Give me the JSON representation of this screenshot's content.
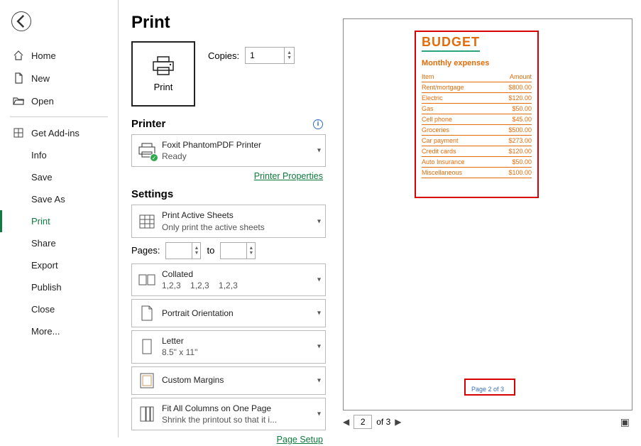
{
  "nav": {
    "home": "Home",
    "new": "New",
    "open": "Open",
    "addins": "Get Add-ins",
    "info": "Info",
    "save": "Save",
    "saveas": "Save As",
    "print": "Print",
    "share": "Share",
    "export": "Export",
    "publish": "Publish",
    "close": "Close",
    "more": "More..."
  },
  "title": "Print",
  "bigbutton": "Print",
  "copies_label": "Copies:",
  "copies_value": "1",
  "printer_heading": "Printer",
  "printer": {
    "name": "Foxit PhantomPDF Printer",
    "status": "Ready"
  },
  "printer_props": "Printer Properties",
  "settings_heading": "Settings",
  "pages_label": "Pages:",
  "to_label": "to",
  "opt": {
    "sheets": {
      "t": "Print Active Sheets",
      "s": "Only print the active sheets"
    },
    "collate": {
      "t": "Collated",
      "s": "1,2,3    1,2,3    1,2,3"
    },
    "orient": {
      "t": "Portrait Orientation"
    },
    "paper": {
      "t": "Letter",
      "s": "8.5\" x 11\""
    },
    "margins": {
      "t": "Custom Margins"
    },
    "scale": {
      "t": "Fit All Columns on One Page",
      "s": "Shrink the printout so that it i..."
    }
  },
  "page_setup": "Page Setup",
  "preview": {
    "heading": "BUDGET",
    "subheading": "Monthly expenses",
    "col1": "Item",
    "col2": "Amount",
    "rows": [
      {
        "i": "Rent/mortgage",
        "a": "$800.00"
      },
      {
        "i": "Electric",
        "a": "$120.00"
      },
      {
        "i": "Gas",
        "a": "$50.00"
      },
      {
        "i": "Cell phone",
        "a": "$45.00"
      },
      {
        "i": "Groceries",
        "a": "$500.00"
      },
      {
        "i": "Car payment",
        "a": "$273.00"
      },
      {
        "i": "Credit cards",
        "a": "$120.00"
      },
      {
        "i": "Auto Insurance",
        "a": "$50.00"
      },
      {
        "i": "Miscellaneous",
        "a": "$100.00"
      }
    ],
    "footer": "Page 2 of 3"
  },
  "navrow": {
    "current": "2",
    "total": "of 3"
  }
}
